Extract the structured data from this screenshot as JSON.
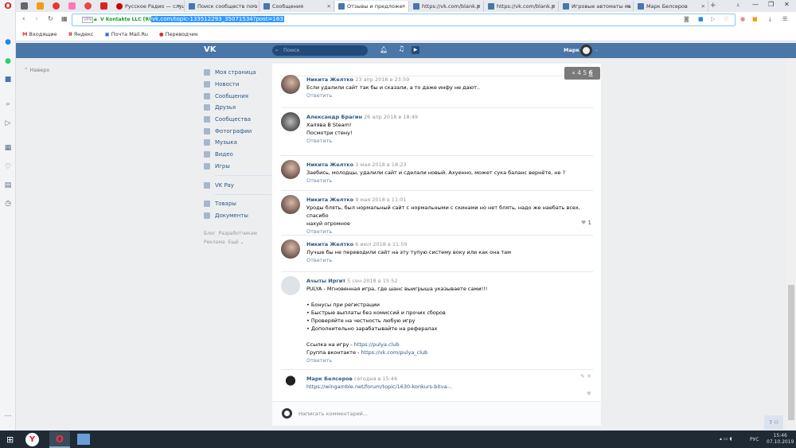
{
  "browser": {
    "tabs": [
      {
        "label": "Русское Радио — слуш"
      },
      {
        "label": "Поиск сообществ по з"
      },
      {
        "label": "Сообщения"
      },
      {
        "label": "Отзывы и предложе"
      },
      {
        "label": "https://vk.com/blank.p"
      },
      {
        "label": "https://vk.com/blank.p"
      },
      {
        "label": "Игровые автоматы ка"
      },
      {
        "label": "Марк Белсеров"
      }
    ],
    "cert": "V Kontakte LLC [RU]",
    "vpn": "VPN",
    "url": "vk.com/topic-133512293_35071534?post=163",
    "bookmarks": [
      "Входящие",
      "Яндекс",
      "Почта Mail.Ru",
      "Переводчик"
    ]
  },
  "vk": {
    "search_placeholder": "Поиск",
    "user": "Марк",
    "back": "Наверх",
    "menu": [
      "Моя страница",
      "Новости",
      "Сообщения",
      "Друзья",
      "Сообщества",
      "Фотографии",
      "Музыка",
      "Видео",
      "Игры"
    ],
    "menu2": [
      "VK Pay"
    ],
    "menu3": [
      "Товары",
      "Документы"
    ],
    "footer": [
      "Блог",
      "Разработчикам",
      "Реклама",
      "Ещё ⌄"
    ],
    "pager": {
      "prev": "«",
      "pages": [
        "4",
        "5",
        "6"
      ],
      "current": "6"
    },
    "reply": "Ответить",
    "posts": [
      {
        "author": "Никита Желтко",
        "date": "23 апр 2018 в 23:59",
        "lines": [
          "Если удалили сайт так бы и сказали, а то даже инфу не дают.."
        ]
      },
      {
        "author": "Александр Брагин",
        "date": "26 апр 2018 в 18:49",
        "lines": [
          "Халява В Steam!",
          "Посмотри стену!"
        ]
      },
      {
        "author": "Никита Желтко",
        "date": "3 мая 2018 в 18:23",
        "lines": [
          "Заебись, молодцы, удалили сайт и сделали новый. Ахуенно, может сука баланс вернёте, не ?"
        ]
      },
      {
        "author": "Никита Желтко",
        "date": "9 мая 2018 в 11:01",
        "lines": [
          "Уроды блять, был нормальный сайт с нормальными с скинами но нет блять, надо же наебать всех, спасибо",
          "нахуй огромное"
        ],
        "likes": "1"
      },
      {
        "author": "Никита Желтко",
        "date": "6 июл 2018 в 11:59",
        "lines": [
          "Лучше бы не переводили сайт на эту тупую систему вокy или как она там"
        ]
      },
      {
        "author": "Ачыты Иргит",
        "date": "5 сен 2018 в 15:52",
        "lines": [
          "PULYA - Мгновенная игра, где шанс выигрыша указываете сами!!!",
          "",
          "• Бонусы при регистрации",
          "• Быстрые выплаты без комиссий и прочих сборов",
          "• Проверяйте на честность любую игру",
          "• Дополнительно зарабатывайте на рефералах",
          ""
        ],
        "link1_label": "Ссылка на игру - ",
        "link1": "https://pulya.club",
        "link2_label": "Группа вконтакте - ",
        "link2": "https://vk.com/pulya_club"
      },
      {
        "author": "Марк Белсеров",
        "date": "сегодня в 15:46",
        "link": "https://wingamble.net/forum/topic/1630-konkurs-bitva-.."
      }
    ],
    "comment_placeholder": "Написать комментарий...",
    "chat_badge": "7"
  },
  "taskbar": {
    "lang": "РУС",
    "time": "15:46",
    "date": "07.10.2019"
  }
}
